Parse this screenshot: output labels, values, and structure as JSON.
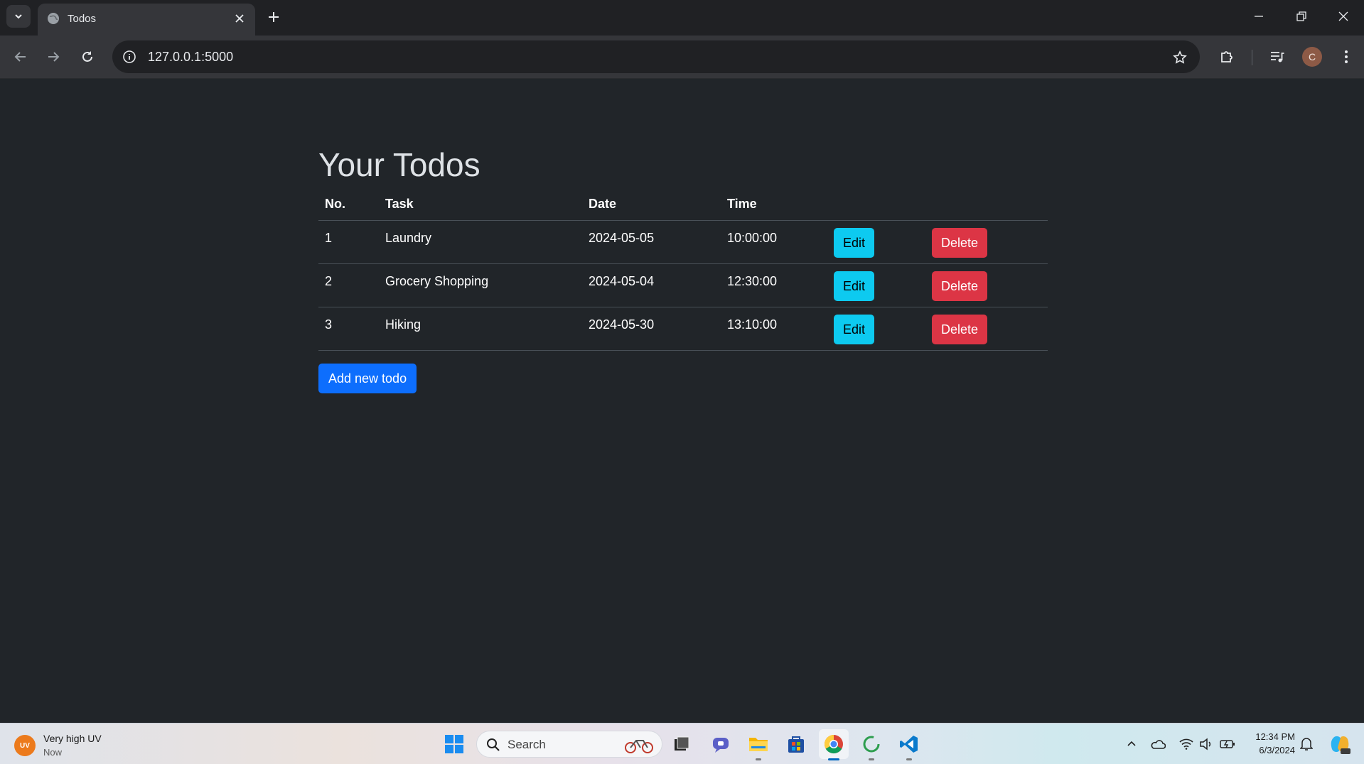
{
  "browser": {
    "tab_title": "Todos",
    "url": "127.0.0.1:5000"
  },
  "page": {
    "title": "Your Todos",
    "columns": [
      "No.",
      "Task",
      "Date",
      "Time"
    ],
    "rows": [
      {
        "no": "1",
        "task": "Laundry",
        "date": "2024-05-05",
        "time": "10:00:00"
      },
      {
        "no": "2",
        "task": "Grocery Shopping",
        "date": "2024-05-04",
        "time": "12:30:00"
      },
      {
        "no": "3",
        "task": "Hiking",
        "date": "2024-05-30",
        "time": "13:10:00"
      }
    ],
    "edit_label": "Edit",
    "delete_label": "Delete",
    "add_label": "Add new todo"
  },
  "taskbar": {
    "weather_badge": "UV",
    "weather_title": "Very high UV",
    "weather_sub": "Now",
    "search_placeholder": "Search",
    "time": "12:34 PM",
    "date": "6/3/2024"
  },
  "profile": {
    "initial": "C"
  },
  "colors": {
    "page_bg": "#212529",
    "edit": "#0dcaf0",
    "delete": "#dc3545",
    "primary": "#0d6efd"
  }
}
